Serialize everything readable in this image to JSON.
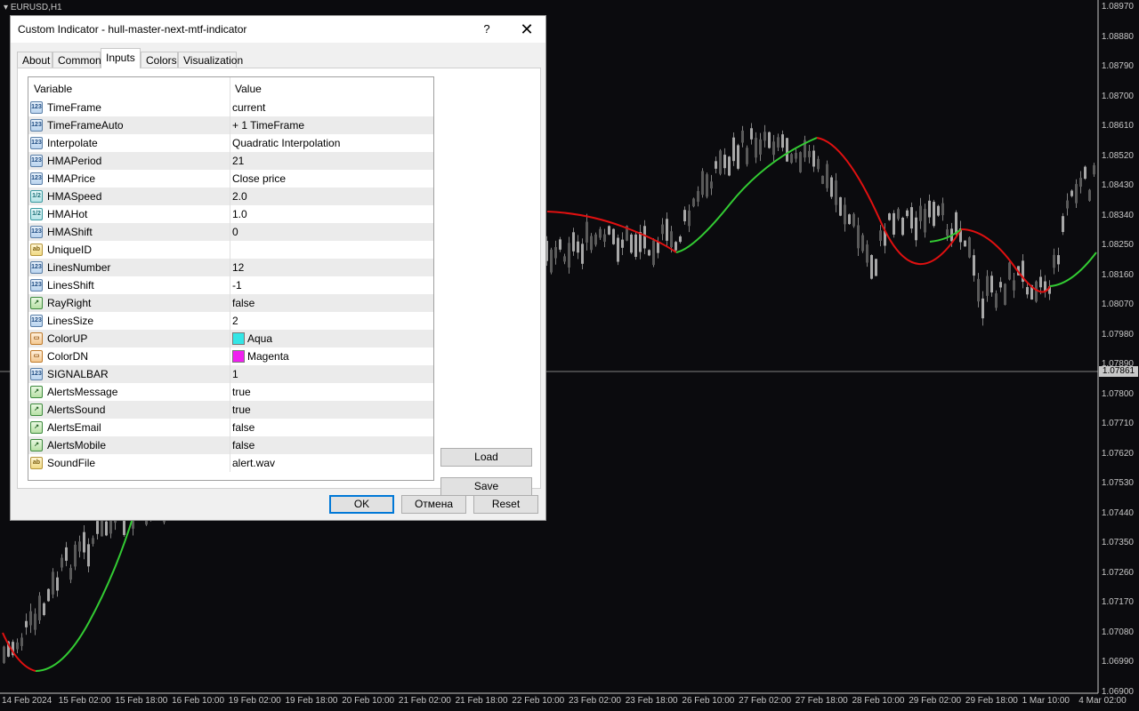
{
  "chart": {
    "symbol": "EURUSD,H1",
    "current_price": "1.07861",
    "price_ticks": [
      "1.08970",
      "1.08880",
      "1.08790",
      "1.08700",
      "1.08610",
      "1.08520",
      "1.08430",
      "1.08340",
      "1.08250",
      "1.08160",
      "1.08070",
      "1.07980",
      "1.07890",
      "1.07800",
      "1.07710",
      "1.07620",
      "1.07530",
      "1.07440",
      "1.07350",
      "1.07260",
      "1.07170",
      "1.07080",
      "1.06990",
      "1.06900"
    ],
    "time_ticks": [
      "14 Feb 2024",
      "15 Feb 02:00",
      "15 Feb 18:00",
      "16 Feb 10:00",
      "19 Feb 02:00",
      "19 Feb 18:00",
      "20 Feb 10:00",
      "21 Feb 02:00",
      "21 Feb 18:00",
      "22 Feb 10:00",
      "23 Feb 02:00",
      "23 Feb 18:00",
      "26 Feb 10:00",
      "27 Feb 02:00",
      "27 Feb 18:00",
      "28 Feb 10:00",
      "29 Feb 02:00",
      "29 Feb 18:00",
      "1 Mar 10:00",
      "4 Mar 02:00"
    ],
    "colors": {
      "up": "#33cc33",
      "down": "#e01010",
      "candles": "#808080"
    }
  },
  "dialog": {
    "title": "Custom Indicator - hull-master-next-mtf-indicator",
    "help": "?",
    "close": "✕",
    "tabs": [
      "About",
      "Common",
      "Inputs",
      "Colors",
      "Visualization"
    ],
    "active_tab": "Inputs",
    "columns": {
      "variable": "Variable",
      "value": "Value"
    },
    "rows": [
      {
        "type": "int",
        "variable": "TimeFrame",
        "value": "current"
      },
      {
        "type": "int",
        "variable": "TimeFrameAuto",
        "value": "+ 1 TimeFrame"
      },
      {
        "type": "int",
        "variable": "Interpolate",
        "value": "Quadratic Interpolation"
      },
      {
        "type": "int",
        "variable": "HMAPeriod",
        "value": "21"
      },
      {
        "type": "int",
        "variable": "HMAPrice",
        "value": "Close price"
      },
      {
        "type": "dbl",
        "variable": "HMASpeed",
        "value": "2.0"
      },
      {
        "type": "dbl",
        "variable": "HMAHot",
        "value": "1.0"
      },
      {
        "type": "int",
        "variable": "HMAShift",
        "value": "0"
      },
      {
        "type": "str",
        "variable": "UniqueID",
        "value": ""
      },
      {
        "type": "int",
        "variable": "LinesNumber",
        "value": "12"
      },
      {
        "type": "int",
        "variable": "LinesShift",
        "value": "-1"
      },
      {
        "type": "bool",
        "variable": "RayRight",
        "value": "false"
      },
      {
        "type": "int",
        "variable": "LinesSize",
        "value": "2"
      },
      {
        "type": "col",
        "variable": "ColorUP",
        "value": "Aqua",
        "swatch": "#33e6e6"
      },
      {
        "type": "col",
        "variable": "ColorDN",
        "value": "Magenta",
        "swatch": "#f020f0"
      },
      {
        "type": "int",
        "variable": "SIGNALBAR",
        "value": "1"
      },
      {
        "type": "bool",
        "variable": "AlertsMessage",
        "value": "true"
      },
      {
        "type": "bool",
        "variable": "AlertsSound",
        "value": "true"
      },
      {
        "type": "bool",
        "variable": "AlertsEmail",
        "value": "false"
      },
      {
        "type": "bool",
        "variable": "AlertsMobile",
        "value": "false"
      },
      {
        "type": "str",
        "variable": "SoundFile",
        "value": "alert.wav"
      }
    ],
    "icon_text": {
      "int": "123",
      "dbl": "1/2",
      "str": "ab",
      "bool": "↗",
      "col": "▭"
    },
    "buttons": {
      "load": "Load",
      "save": "Save",
      "ok": "OK",
      "cancel": "Отмена",
      "reset": "Reset"
    }
  }
}
